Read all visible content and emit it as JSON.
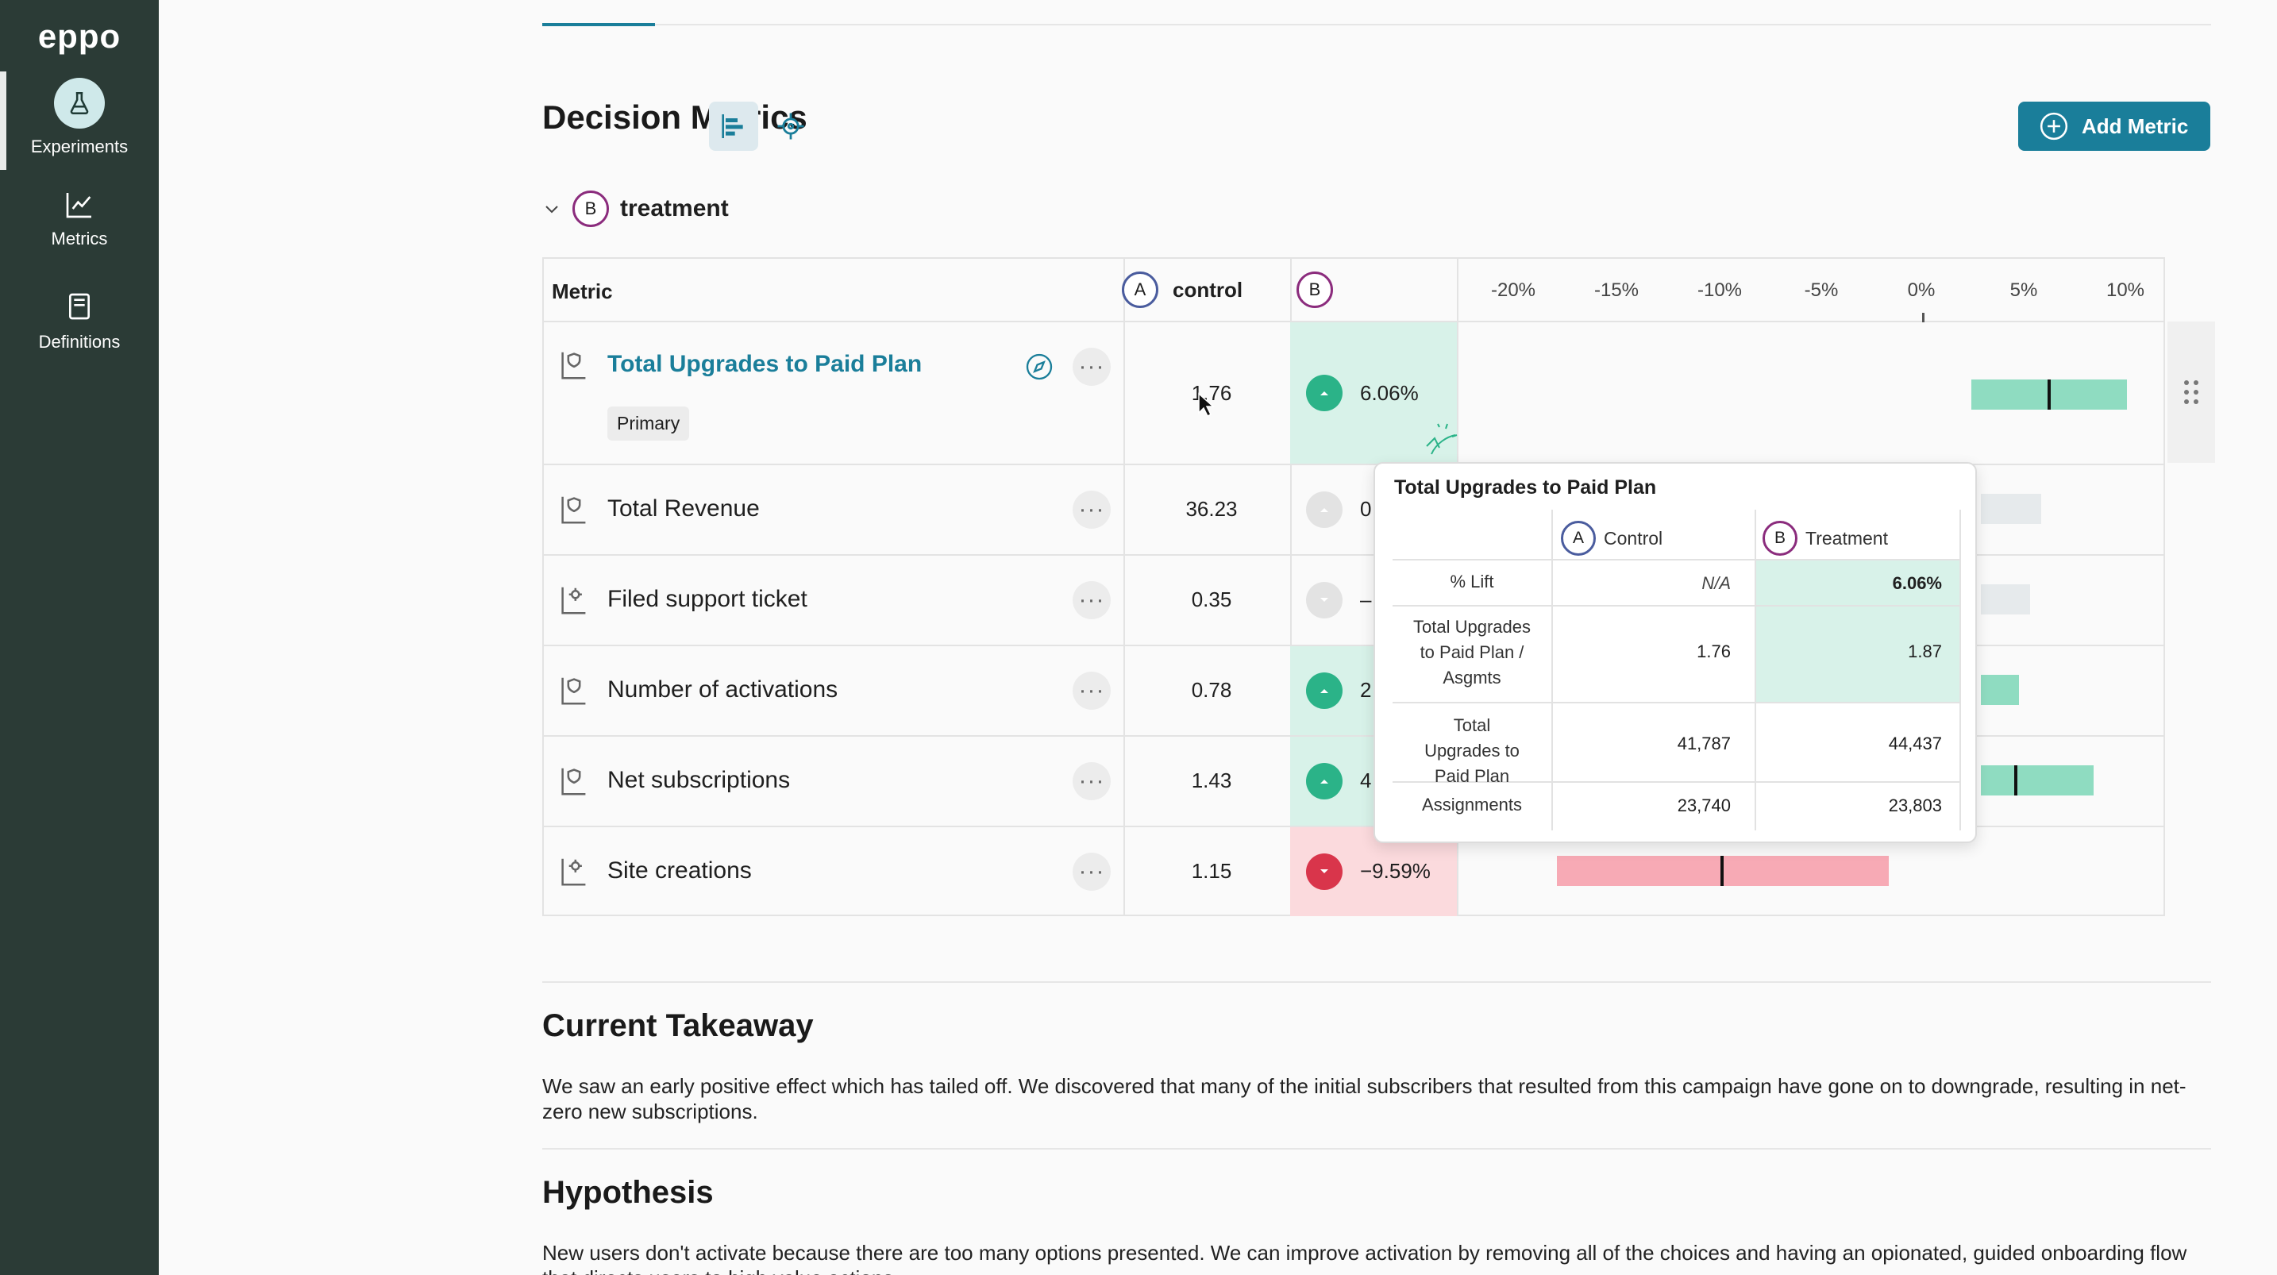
{
  "app": {
    "logo": "eppo"
  },
  "sidebar": {
    "items": [
      {
        "label": "Experiments",
        "icon": "flask-icon",
        "active": true
      },
      {
        "label": "Metrics",
        "icon": "line-chart-icon",
        "active": false
      },
      {
        "label": "Definitions",
        "icon": "book-icon",
        "active": false
      }
    ]
  },
  "section": {
    "title": "Decision Metrics",
    "add_metric_label": "Add Metric"
  },
  "variant": {
    "badge": "B",
    "name": "treatment"
  },
  "table": {
    "headers": {
      "metric": "Metric",
      "control_badge": "A",
      "control": "control",
      "treatment_badge": "B"
    },
    "ticks": [
      "-20%",
      "-15%",
      "-10%",
      "-5%",
      "0%",
      "5%",
      "10%"
    ],
    "rows": [
      {
        "name": "Total Upgrades to Paid Plan",
        "tag": "Primary",
        "control": "1.76",
        "lift": "6.06%",
        "direction": "up",
        "ci_low": 2.4,
        "ci_point": 6.06,
        "ci_high": 9.8
      },
      {
        "name": "Total Revenue",
        "control": "36.23",
        "lift": "0",
        "direction": "neutral"
      },
      {
        "name": "Filed support ticket",
        "control": "0.35",
        "lift": "–",
        "direction": "neutral"
      },
      {
        "name": "Number of activations",
        "control": "0.78",
        "lift": "2",
        "direction": "up"
      },
      {
        "name": "Net subscriptions",
        "control": "1.43",
        "lift": "4",
        "direction": "up"
      },
      {
        "name": "Site creations",
        "control": "1.15",
        "lift": "−9.59%",
        "direction": "down",
        "ci_low": -17.6,
        "ci_point": -9.59,
        "ci_high": -1.5
      }
    ]
  },
  "tooltip": {
    "title": "Total Upgrades to Paid Plan",
    "col_a_badge": "A",
    "col_a": "Control",
    "col_b_badge": "B",
    "col_b": "Treatment",
    "rows": [
      {
        "label": "% Lift",
        "control": "N/A",
        "treatment": "6.06%"
      },
      {
        "label": "Total Upgrades to Paid Plan / Asgmts",
        "control": "1.76",
        "treatment": "1.87"
      },
      {
        "label": "Total Upgrades to Paid Plan",
        "control": "41,787",
        "treatment": "44,437"
      },
      {
        "label": "Assignments",
        "control": "23,740",
        "treatment": "23,803"
      }
    ]
  },
  "takeaway": {
    "title": "Current Takeaway",
    "text": "We saw an early positive effect which has tailed off. We discovered that many of the initial subscribers that resulted from this campaign have gone on to downgrade, resulting in net-zero new subscriptions."
  },
  "hypothesis": {
    "title": "Hypothesis",
    "text": "New users don't activate because there are too many options presented. We can improve activation by removing all of the choices and having an opionated, guided onboarding flow that directs users to high value actions."
  }
}
